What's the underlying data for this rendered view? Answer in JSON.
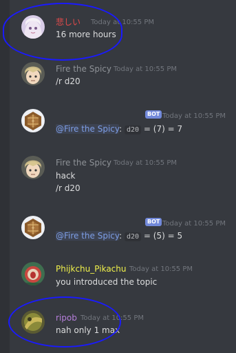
{
  "messages": [
    {
      "author": "悲しい",
      "author_color": "#e64b4b",
      "timestamp": "Today at 10:55 PM",
      "lines": [
        "16 more hours"
      ]
    },
    {
      "author": "Fire the Spicy",
      "author_color": "#8e9297",
      "timestamp": "Today at 10:55 PM",
      "lines": [
        "/r d20"
      ]
    },
    {
      "bot_tag": "BOT",
      "timestamp": "Today at 10:55 PM",
      "mention": "@Fire the Spicy",
      "sep": ":",
      "dice": "d20",
      "result": "= (7) = 7"
    },
    {
      "author": "Fire the Spicy",
      "author_color": "#8e9297",
      "timestamp": "Today at 10:55 PM",
      "lines": [
        "hack",
        "/r d20"
      ]
    },
    {
      "bot_tag": "BOT",
      "timestamp": "Today at 10:55 PM",
      "mention": "@Fire the Spicy",
      "sep": ":",
      "dice": "d20",
      "result": "= (5) = 5"
    },
    {
      "author": "Phijkchu_Pikachu",
      "author_color": "#f1f24b",
      "timestamp": "Today at 10:55 PM",
      "lines": [
        "you introduced the topic"
      ]
    },
    {
      "author": "ripob",
      "author_color": "#b77fdc",
      "timestamp": "Today at 10:55 PM",
      "lines": [
        "nah only 1 max"
      ]
    }
  ]
}
